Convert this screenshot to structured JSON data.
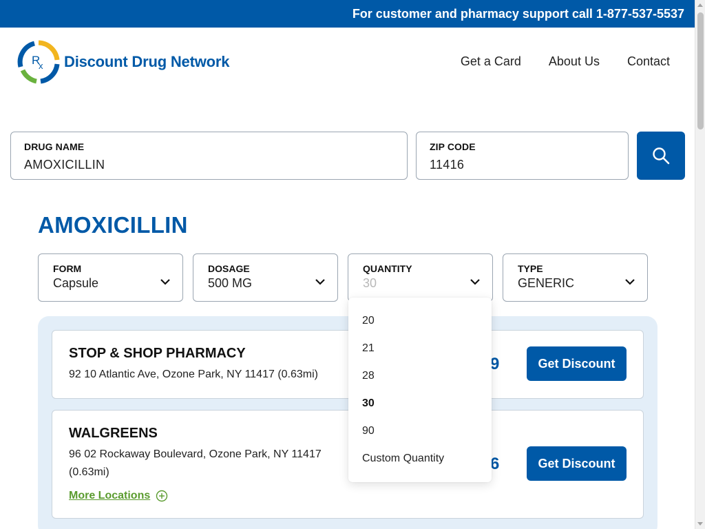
{
  "topbar": {
    "support_text": "For customer and pharmacy support call 1-877-537-5537"
  },
  "logo": {
    "text": "Discount Drug Network",
    "monogram": "Rx"
  },
  "nav": {
    "items": [
      {
        "label": "Get a Card"
      },
      {
        "label": "About Us"
      },
      {
        "label": "Contact"
      }
    ]
  },
  "search": {
    "drug": {
      "label": "DRUG NAME",
      "value": "AMOXICILLIN"
    },
    "zip": {
      "label": "ZIP CODE",
      "value": "11416"
    },
    "button_icon": "search-icon"
  },
  "drug_title": "AMOXICILLIN",
  "filters": {
    "form": {
      "label": "FORM",
      "value": "Capsule"
    },
    "dosage": {
      "label": "DOSAGE",
      "value": "500 MG"
    },
    "quantity": {
      "label": "QUANTITY",
      "value": "30"
    },
    "type": {
      "label": "TYPE",
      "value": "GENERIC"
    }
  },
  "quantity_dropdown": {
    "options": [
      "20",
      "21",
      "28",
      "30",
      "90",
      "Custom Quantity"
    ],
    "selected": "30"
  },
  "pharmacies": [
    {
      "name": "STOP & SHOP PHARMACY",
      "address": "92 10 Atlantic Ave, Ozone Park, NY 11417 (0.63mi)",
      "price_visible": "9",
      "button": "Get Discount"
    },
    {
      "name": "WALGREENS",
      "address": "96 02 Rockaway Boulevard, Ozone Park, NY 11417 (0.63mi)",
      "price_visible": "6",
      "button": "Get Discount",
      "more_locations": "More Locations"
    }
  ],
  "colors": {
    "brand_blue": "#0059a7",
    "accent_green": "#5a9b2e",
    "results_bg": "#e3eef8"
  }
}
